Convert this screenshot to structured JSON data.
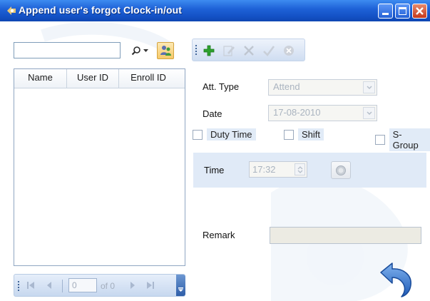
{
  "window": {
    "title": "Append user's forgot Clock-in/out",
    "controls": [
      "minimize-icon",
      "maximize-icon",
      "close-icon"
    ]
  },
  "colors": {
    "titlebar": "#1f63d8",
    "accent_add": "#2ea12e",
    "undo": "#2f6fc5"
  },
  "search": {
    "value": "",
    "placeholder": ""
  },
  "list": {
    "columns": [
      "Name",
      "User ID",
      "Enroll ID"
    ],
    "rows": []
  },
  "pager": {
    "page": "0",
    "of_text": "of 0"
  },
  "toolbar": {
    "items": [
      "add-icon",
      "edit-icon",
      "delete-icon",
      "confirm-icon",
      "cancel-icon"
    ]
  },
  "form": {
    "att_type_label": "Att. Type",
    "att_type_value": "Attend",
    "date_label": "Date",
    "date_value": "17-08-2010",
    "duty_time_label": "Duty Time",
    "shift_label": "Shift",
    "s_group_label": "S-Group",
    "time_label": "Time",
    "time_value": "17:32",
    "remark_label": "Remark",
    "remark_value": ""
  }
}
